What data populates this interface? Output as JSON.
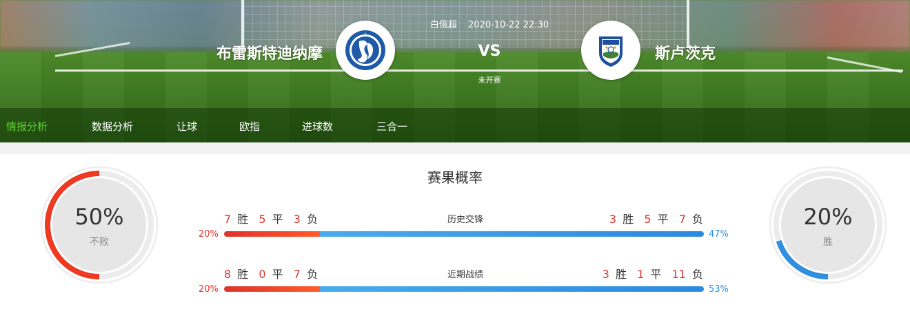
{
  "match": {
    "league": "白俄超",
    "datetime": "2020-10-22 22:30",
    "vs_label": "VS",
    "status": "未开赛",
    "home_team": "布雷斯特迪纳摩",
    "away_team": "斯卢茨克"
  },
  "tabs": [
    {
      "label": "情报分析",
      "active": true
    },
    {
      "label": "数据分析",
      "active": false
    },
    {
      "label": "让球",
      "active": false
    },
    {
      "label": "欧指",
      "active": false
    },
    {
      "label": "进球数",
      "active": false
    },
    {
      "label": "三合一",
      "active": false
    }
  ],
  "section_title": "赛果概率",
  "probability": {
    "home": {
      "pct_text": "50%",
      "label": "不败",
      "fraction": 0.5,
      "color": "#ee3a22"
    },
    "away": {
      "pct_text": "20%",
      "label": "胜",
      "fraction": 0.2,
      "color": "#2f8fe0"
    }
  },
  "stats": [
    {
      "title": "历史交锋",
      "home": {
        "w": "7",
        "d": "5",
        "l": "3"
      },
      "away": {
        "w": "3",
        "d": "5",
        "l": "7"
      },
      "home_pct": "20%",
      "away_pct": "47%",
      "home_fraction": 0.2
    },
    {
      "title": "近期战绩",
      "home": {
        "w": "8",
        "d": "0",
        "l": "7"
      },
      "away": {
        "w": "3",
        "d": "1",
        "l": "11"
      },
      "home_pct": "20%",
      "away_pct": "53%",
      "home_fraction": 0.2
    }
  ],
  "labels": {
    "win": "胜",
    "draw": "平",
    "loss": "负"
  },
  "colors": {
    "active_tab": "#5fd132",
    "home_accent": "#e0322b",
    "away_accent": "#2f8fe0"
  },
  "icons": {
    "home_logo": "dynamo-brest-logo",
    "away_logo": "slutsk-logo"
  }
}
